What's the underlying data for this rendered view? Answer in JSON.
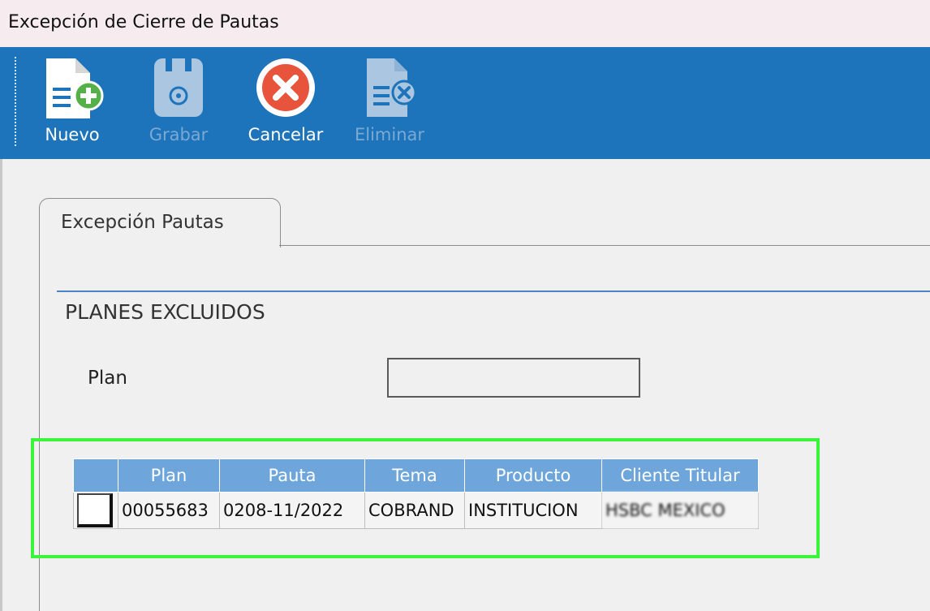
{
  "window": {
    "title": "Excepción de Cierre de Pautas"
  },
  "toolbar": {
    "buttons": [
      {
        "label": "Nuevo",
        "icon": "new-document-icon",
        "enabled": true
      },
      {
        "label": "Grabar",
        "icon": "save-icon",
        "enabled": false
      },
      {
        "label": "Cancelar",
        "icon": "cancel-icon",
        "enabled": true
      },
      {
        "label": "Eliminar",
        "icon": "delete-document-icon",
        "enabled": false
      }
    ]
  },
  "tabs": [
    {
      "label": "Excepción Pautas",
      "active": true
    }
  ],
  "section": {
    "title": "PLANES EXCLUIDOS"
  },
  "form": {
    "plan_label": "Plan",
    "plan_value": ""
  },
  "grid": {
    "columns": [
      "",
      "Plan",
      "Pauta",
      "Tema",
      "Producto",
      "Cliente Titular"
    ],
    "rows": [
      {
        "checked": false,
        "plan": "00055683",
        "pauta": "0208-11/2022",
        "tema": "COBRAND",
        "producto": "INSTITUCION",
        "cliente_titular": "HSBC MEXICO"
      }
    ]
  },
  "colors": {
    "toolbar": "#1d74ba",
    "grid_header": "#6ea6dc",
    "highlight": "#3bf53b"
  }
}
